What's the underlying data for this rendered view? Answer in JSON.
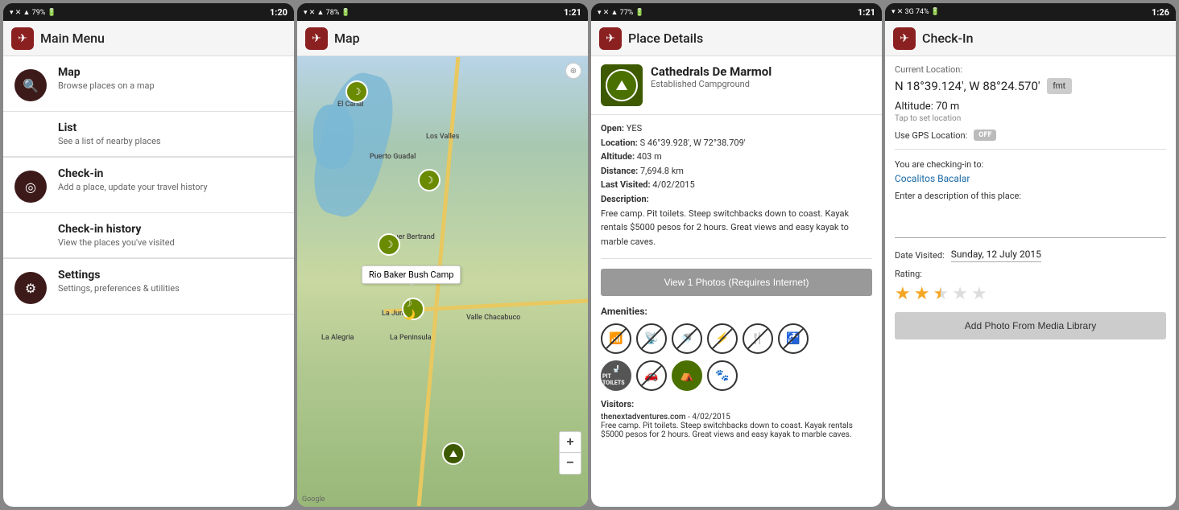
{
  "screens": [
    {
      "id": "main-menu",
      "statusBar": {
        "icons": "▾ ✕ 📶 79%",
        "time": "1:20"
      },
      "header": {
        "title": "Main Menu"
      },
      "menuItems": [
        {
          "icon": "🔍",
          "title": "Map",
          "subtitle": "Browse places on a map"
        },
        {
          "icon": "📍",
          "title": "List",
          "subtitle": "See a list of nearby places"
        },
        {
          "icon": "📌",
          "title": "Check-in",
          "subtitle": "Add a place, update your travel history"
        },
        {
          "icon": "🕐",
          "title": "Check-in history",
          "subtitle": "View the places you've visited"
        },
        {
          "icon": "⚙",
          "title": "Settings",
          "subtitle": "Settings, preferences & utilities"
        }
      ]
    },
    {
      "id": "map",
      "statusBar": {
        "icons": "▾ ✕ 📶 78%",
        "time": "1:21"
      },
      "header": {
        "title": "Map"
      },
      "tooltip": "Rio Baker Bush Camp",
      "googleLabel": "Google"
    },
    {
      "id": "place-details",
      "statusBar": {
        "icons": "▾ ✕ 📶 77%",
        "time": "1:21"
      },
      "header": {
        "title": "Place Details"
      },
      "place": {
        "name": "Cathedrals De Marmol",
        "type": "Established Campground",
        "open": "YES",
        "location": "S 46°39.928', W 72°38.709'",
        "altitude": "403 m",
        "distance": "7,694.8 km",
        "lastVisited": "4/02/2015",
        "description": "Free camp. Pit toilets. Steep switchbacks down to coast. Kayak rentals $5000 pesos for 2 hours. Great views and easy kayak to marble caves.",
        "photoBtnLabel": "View 1 Photos (Requires Internet)",
        "amenitiesTitle": "Amenities:",
        "visitorsTitle": "Visitors:",
        "visitorName": "thenextadventures.com",
        "visitorDate": "4/02/2015",
        "visitorText": "Free camp. Pit toilets. Steep switchbacks down to coast. Kayak rentals $5000 pesos for 2 hours. Great views and easy kayak to marble caves."
      }
    },
    {
      "id": "check-in",
      "statusBar": {
        "icons": "▾ ✕ 3G 74%",
        "time": "1:26"
      },
      "header": {
        "title": "Check-In"
      },
      "currentLocationLabel": "Current Location:",
      "coords": "N 18°39.124', W 88°24.570'",
      "fmtLabel": "fmt",
      "altitudeLabel": "Altitude:",
      "altitude": "70 m",
      "tapSetLabel": "Tap to set location",
      "gpsLabel": "Use GPS Location:",
      "gpsToggle": "OFF",
      "checkingInLabel": "You are checking-in to:",
      "checkingInPlace": "Cocalitos Bacalar",
      "descLabel": "Enter a description of this place:",
      "dateLabel": "Date Visited:",
      "dateValue": "Sunday, 12 July 2015",
      "ratingLabel": "Rating:",
      "photoBtn": "Add Photo From Media Library"
    }
  ]
}
